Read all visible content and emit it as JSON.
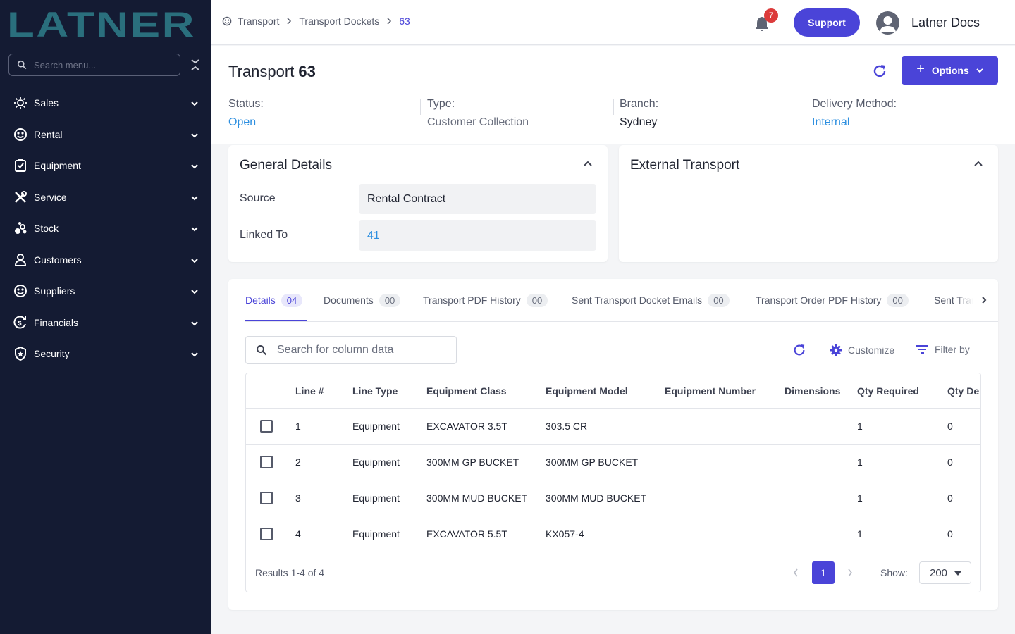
{
  "brand": {
    "logo_text": "LATNER",
    "accent": "#4a44d8",
    "sidebar_bg": "#141b33",
    "link": "#2d8fe0"
  },
  "sidebar": {
    "search_placeholder": "Search menu...",
    "items": [
      {
        "label": "Sales",
        "icon": "sales-icon"
      },
      {
        "label": "Rental",
        "icon": "rental-icon"
      },
      {
        "label": "Equipment",
        "icon": "equipment-icon"
      },
      {
        "label": "Service",
        "icon": "service-icon"
      },
      {
        "label": "Stock",
        "icon": "stock-icon"
      },
      {
        "label": "Customers",
        "icon": "customers-icon"
      },
      {
        "label": "Suppliers",
        "icon": "suppliers-icon"
      },
      {
        "label": "Financials",
        "icon": "financials-icon"
      },
      {
        "label": "Security",
        "icon": "security-icon"
      }
    ]
  },
  "header": {
    "breadcrumbs": [
      "Transport",
      "Transport Dockets",
      "63"
    ],
    "notification_count": "7",
    "support_label": "Support",
    "user_name": "Latner Docs"
  },
  "page": {
    "title": "Transport",
    "number": "63",
    "options_label": "Options",
    "meta": [
      {
        "label": "Status:",
        "value": "Open",
        "color": "#2d8fe0"
      },
      {
        "label": "Type:",
        "value": "Customer Collection",
        "color": "#6a6f7e"
      },
      {
        "label": "Branch:",
        "value": "Sydney",
        "color": "#1f2330"
      },
      {
        "label": "Delivery Method:",
        "value": "Internal",
        "color": "#2d8fe0"
      }
    ]
  },
  "general_details": {
    "title": "General Details",
    "fields": [
      {
        "label": "Source",
        "value": "Rental Contract"
      },
      {
        "label": "Linked To",
        "value": "41"
      }
    ]
  },
  "external_transport": {
    "title": "External Transport"
  },
  "tabs": [
    {
      "label": "Details",
      "count": "04"
    },
    {
      "label": "Documents",
      "count": "00"
    },
    {
      "label": "Transport PDF History",
      "count": "00"
    },
    {
      "label": "Sent Transport Docket Emails",
      "count": "00"
    },
    {
      "label": "Transport Order PDF History",
      "count": "00"
    },
    {
      "label": "Sent Tran",
      "count": ""
    }
  ],
  "table": {
    "search_placeholder": "Search for column data",
    "customize_label": "Customize",
    "filter_label": "Filter by",
    "columns": [
      "Line #",
      "Line Type",
      "Equipment Class",
      "Equipment Model",
      "Equipment Number",
      "Dimensions",
      "Qty Required",
      "Qty De"
    ],
    "rows": [
      [
        "1",
        "Equipment",
        "EXCAVATOR 3.5T",
        "303.5 CR",
        "",
        "",
        "1",
        "0"
      ],
      [
        "2",
        "Equipment",
        "300MM GP BUCKET",
        "300MM GP BUCKET",
        "",
        "",
        "1",
        "0"
      ],
      [
        "3",
        "Equipment",
        "300MM MUD BUCKET",
        "300MM MUD BUCKET",
        "",
        "",
        "1",
        "0"
      ],
      [
        "4",
        "Equipment",
        "EXCAVATOR 5.5T",
        "KX057-4",
        "",
        "",
        "1",
        "0"
      ]
    ],
    "results_text": "Results 1-4 of 4",
    "current_page": "1",
    "show_label": "Show:",
    "page_size": "200"
  }
}
